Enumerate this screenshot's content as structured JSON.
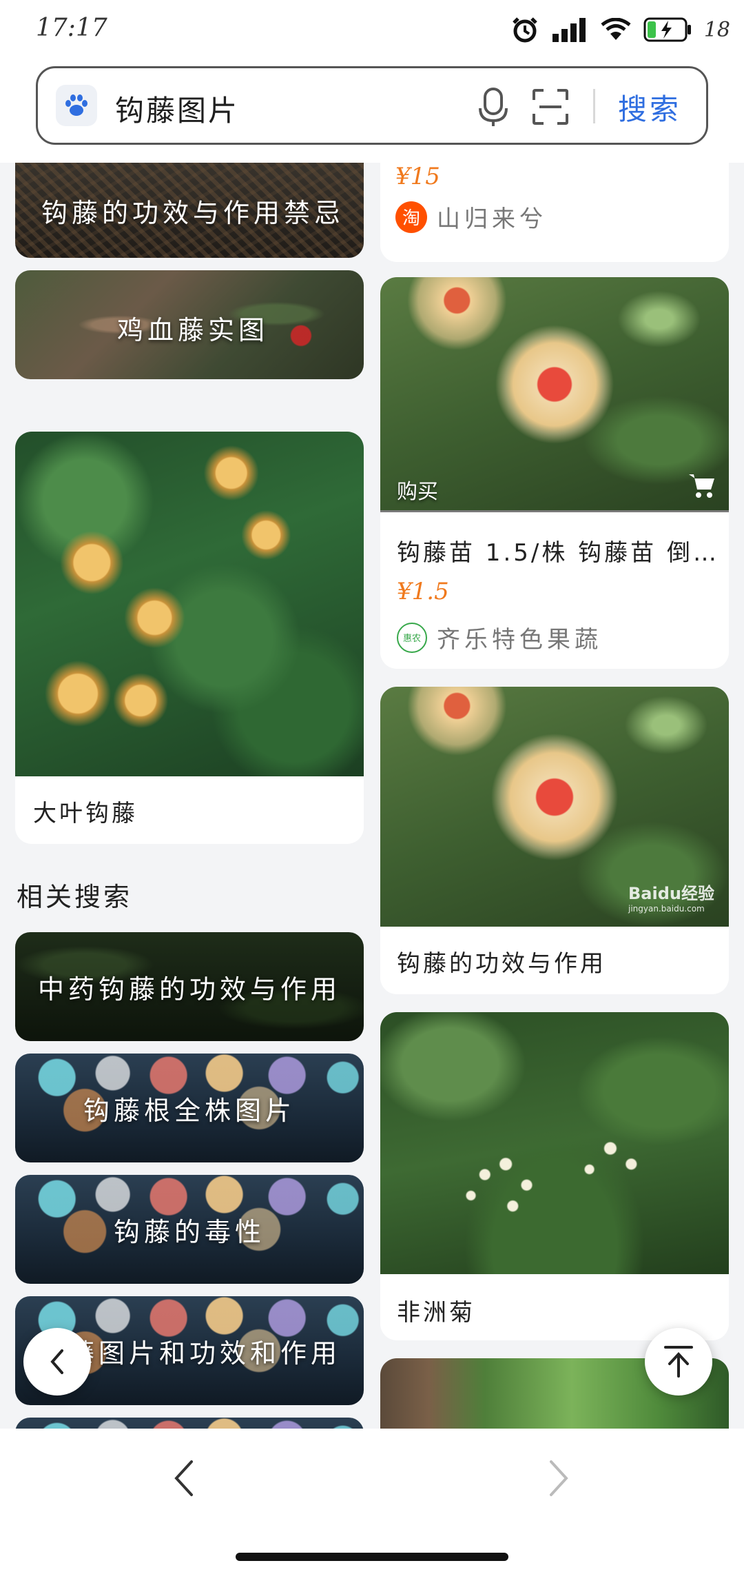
{
  "status_bar": {
    "time": "17:17",
    "battery": "18"
  },
  "search": {
    "query": "钩藤图片",
    "button_label": "搜索"
  },
  "left_column": {
    "top_caption": "钩藤的功效与作用禁忌",
    "second_caption": "鸡血藤实图",
    "card_title": "大叶钩藤"
  },
  "right_column": {
    "card1": {
      "price": "¥15",
      "shop_name": "山归来兮",
      "shop_icon": "淘"
    },
    "card2": {
      "buy_label": "购买",
      "title": "钩藤苗 1.5/株 钩藤苗 倒…",
      "price": "¥1.5",
      "shop_name": "齐乐特色果蔬",
      "shop_icon": "惠农"
    },
    "card3": {
      "title": "钩藤的功效与作用",
      "watermark": "Baidu经验",
      "watermark_sub": "jingyan.baidu.com"
    },
    "card4": {
      "title": "非洲菊"
    }
  },
  "related": {
    "title": "相关搜索",
    "items": [
      {
        "label": "中药钩藤的功效与作用"
      },
      {
        "label": "钩藤根全株图片"
      },
      {
        "label": "钩藤的毒性"
      },
      {
        "label": "钩藤图片和功效和作用"
      }
    ]
  },
  "colors": {
    "accent": "#2f6ee0",
    "price": "#f07a1e",
    "taobao": "#ff5000"
  }
}
